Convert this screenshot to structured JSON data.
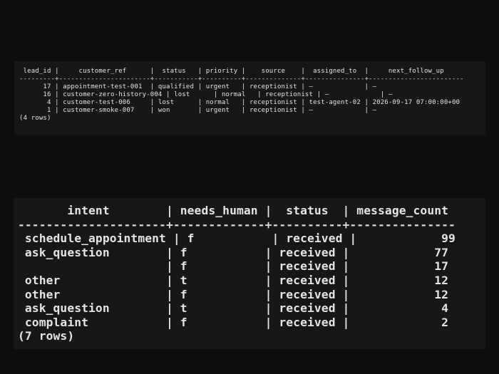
{
  "query_results": [
    {
      "columns": [
        "lead_id",
        "customer_ref",
        "status",
        "priority",
        "source",
        "assigned_to",
        "next_follow_up"
      ],
      "header_line": " lead_id |     customer_ref      |  status   | priority |    source    |  assigned_to  |     next_follow_up",
      "separator_line": "---------+-----------------------+-----------+----------+--------------+---------------+------------------------",
      "rows": [
        {
          "lead_id": 17,
          "customer_ref": "appointment-test-001",
          "status": "qualified",
          "priority": "urgent",
          "source": "receptionist",
          "assigned_to": "–",
          "next_follow_up": "–",
          "line": "      17 | appointment-test-001  | qualified | urgent   | receptionist | –             | –"
        },
        {
          "lead_id": 16,
          "customer_ref": "customer-zero-history-004",
          "status": "lost",
          "priority": "normal",
          "source": "receptionist",
          "assigned_to": "–",
          "next_follow_up": "–",
          "line": "      16 | customer-zero-history-004 | lost      | normal   | receptionist | –             | –"
        },
        {
          "lead_id": 4,
          "customer_ref": "customer-test-006",
          "status": "lost",
          "priority": "normal",
          "source": "receptionist",
          "assigned_to": "test-agent-02",
          "next_follow_up": "2026-09-17 07:00:00+00",
          "line": "       4 | customer-test-006     | lost      | normal   | receptionist | test-agent-02 | 2026-09-17 07:00:00+00"
        },
        {
          "lead_id": 1,
          "customer_ref": "customer-smoke-007",
          "status": "won",
          "priority": "urgent",
          "source": "receptionist",
          "assigned_to": "–",
          "next_follow_up": "–",
          "line": "       1 | customer-smoke-007    | won       | urgent   | receptionist | –             | –"
        }
      ],
      "footer": "(4 rows)"
    },
    {
      "columns": [
        "intent",
        "needs_human",
        "status",
        "message_count"
      ],
      "header_line": "       intent        | needs_human |  status  | message_count",
      "separator_line": "---------------------+-------------+----------+---------------",
      "rows": [
        {
          "intent": "schedule_appointment",
          "needs_human": "f",
          "status": "received",
          "message_count": 99,
          "line": " schedule_appointment | f           | received |            99"
        },
        {
          "intent": "ask_question",
          "needs_human": "f",
          "status": "received",
          "message_count": 77,
          "line": " ask_question        | f           | received |            77"
        },
        {
          "intent": "",
          "needs_human": "f",
          "status": "received",
          "message_count": 17,
          "line": "                     | f           | received |            17"
        },
        {
          "intent": "other",
          "needs_human": "t",
          "status": "received",
          "message_count": 12,
          "line": " other               | t           | received |            12"
        },
        {
          "intent": "other",
          "needs_human": "f",
          "status": "received",
          "message_count": 12,
          "line": " other               | f           | received |            12"
        },
        {
          "intent": "ask_question",
          "needs_human": "t",
          "status": "received",
          "message_count": 4,
          "line": " ask_question        | t           | received |             4"
        },
        {
          "intent": "complaint",
          "needs_human": "f",
          "status": "received",
          "message_count": 2,
          "line": " complaint           | f           | received |             2"
        }
      ],
      "footer": "(7 rows)"
    }
  ]
}
